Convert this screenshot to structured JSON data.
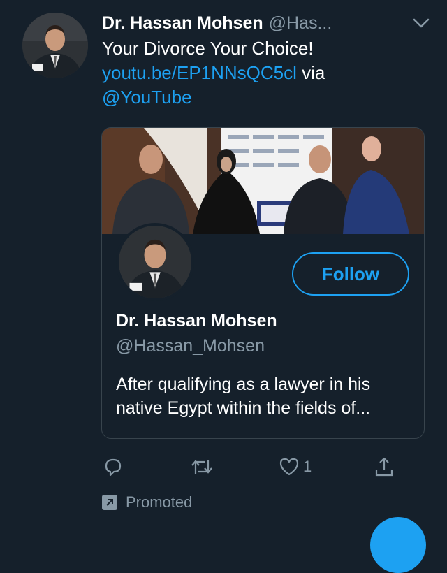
{
  "tweet": {
    "author_name": "Dr. Hassan Mohsen",
    "author_handle": "@Has...",
    "text_line1": "Your Divorce Your Choice!",
    "link": "youtu.be/EP1NNsQC5cl",
    "via": " via",
    "mention": "@YouTube"
  },
  "card": {
    "follow_label": "Follow",
    "name": "Dr. Hassan Mohsen",
    "handle": "@Hassan_Mohsen",
    "bio": "After qualifying as a lawyer in his native Egypt within the fields of..."
  },
  "actions": {
    "like_count": "1"
  },
  "promoted_label": "Promoted",
  "icons": [
    "chevron-down-icon",
    "reply-icon",
    "retweet-icon",
    "heart-icon",
    "share-icon",
    "promoted-arrow-icon"
  ],
  "colors": {
    "background": "#15202b",
    "accent": "#1da1f2",
    "muted": "#8899a6",
    "border": "#38444d"
  }
}
